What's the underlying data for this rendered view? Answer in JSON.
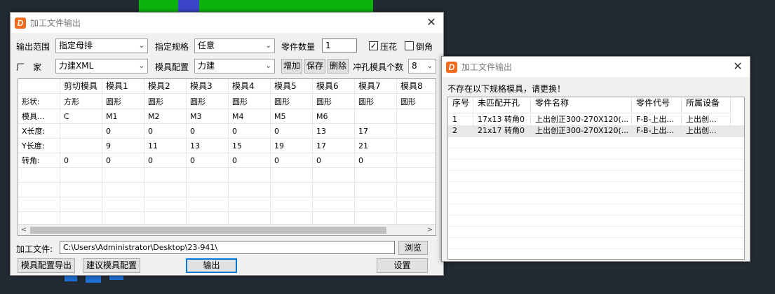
{
  "main_window": {
    "title": "加工文件输出",
    "row1": {
      "range_label": "输出范围",
      "range_value": "指定母排",
      "spec_label": "指定规格",
      "spec_value": "任意",
      "qty_label": "零件数量",
      "qty_value": "1",
      "emboss_label": "压花",
      "emboss_checked": "✓",
      "chamfer_label": "倒角"
    },
    "row2": {
      "vendor_label": "厂　家",
      "vendor_value": "力建XML",
      "config_label": "模具配置",
      "config_value": "力建",
      "add_label": "增加",
      "save_label": "保存",
      "delete_label": "删除",
      "punch_label": "冲孔模具个数",
      "punch_value": "8"
    },
    "grid": {
      "columns": [
        "",
        "剪切模具",
        "模具1",
        "模具2",
        "模具3",
        "模具4",
        "模具5",
        "模具6",
        "模具7",
        "模具8"
      ],
      "rows": [
        [
          "形状:",
          "方形",
          "圆形",
          "圆形",
          "圆形",
          "圆形",
          "圆形",
          "圆形",
          "圆形",
          "圆形"
        ],
        [
          "模具...",
          "C",
          "M1",
          "M2",
          "M3",
          "M4",
          "M5",
          "M6",
          "",
          ""
        ],
        [
          "X长度:",
          "",
          "0",
          "0",
          "0",
          "0",
          "0",
          "13",
          "17",
          ""
        ],
        [
          "Y长度:",
          "",
          "9",
          "11",
          "13",
          "15",
          "19",
          "17",
          "21",
          ""
        ],
        [
          "转角:",
          "0",
          "0",
          "0",
          "0",
          "0",
          "0",
          "0",
          "0",
          ""
        ]
      ]
    },
    "file_label": "加工文件:",
    "file_path": "C:\\Users\\Administrator\\Desktop\\23-941\\",
    "browse_label": "浏览",
    "export_config_label": "模具配置导出",
    "suggest_config_label": "建议模具配置",
    "output_label": "输出",
    "settings_label": "设置"
  },
  "second_window": {
    "title": "加工文件输出",
    "message": "不存在以下规格模具，请更换！",
    "columns": [
      "序号",
      "未匹配开孔",
      "零件名称",
      "零件代号",
      "所属设备"
    ],
    "rows": [
      [
        "1",
        "17x13 转角0",
        "上出创正300-270X120(...",
        "F-B-上出...",
        "上出创..."
      ],
      [
        "2",
        "21x17 转角0",
        "上出创正300-270X120(...",
        "F-B-上出...",
        "上出创..."
      ]
    ]
  }
}
